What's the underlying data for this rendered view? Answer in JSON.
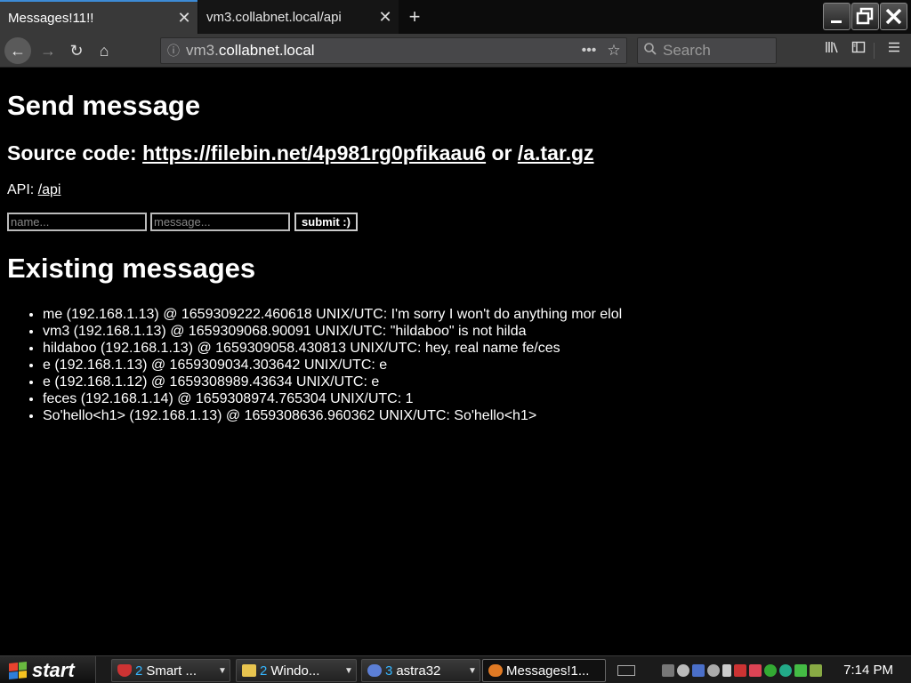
{
  "browser": {
    "tabs": [
      {
        "title": "Messages!11!!",
        "active": true
      },
      {
        "title": "vm3.collabnet.local/api",
        "active": false
      }
    ],
    "url": {
      "prefix": "vm3.",
      "domain": "collabnet.local"
    },
    "search_placeholder": "Search"
  },
  "page": {
    "title": "Send message",
    "source_label": "Source code:",
    "source_link": "https://filebin.net/4p981rg0pfikaau6",
    "source_or": "or",
    "source_link2": "/a.tar.gz",
    "api_label": "API:",
    "api_link": "/api",
    "form": {
      "name_placeholder": "name...",
      "message_placeholder": "message...",
      "submit_label": "submit :)"
    },
    "existing_title": "Existing messages",
    "messages": [
      "me (192.168.1.13) @ 1659309222.460618 UNIX/UTC: I'm sorry I won't do anything mor elol",
      "vm3 (192.168.1.13) @ 1659309068.90091 UNIX/UTC: \"hildaboo\" is not hilda",
      "hildaboo (192.168.1.13) @ 1659309058.430813 UNIX/UTC: hey, real name fe/ces",
      "e (192.168.1.13) @ 1659309034.303642 UNIX/UTC: e",
      "e (192.168.1.12) @ 1659308989.43634 UNIX/UTC: e",
      "feces (192.168.1.14) @ 1659308974.765304 UNIX/UTC: 1",
      "So'hello<h1> (192.168.1.13) @ 1659308636.960362 UNIX/UTC: So'hello<h1>"
    ]
  },
  "taskbar": {
    "start_label": "start",
    "tasks": [
      {
        "count": "2",
        "label": "Smart ..."
      },
      {
        "count": "2",
        "label": "Windo..."
      },
      {
        "count": "3",
        "label": "astra32"
      },
      {
        "count": "",
        "label": "Messages!1..."
      }
    ],
    "clock": "7:14 PM"
  },
  "colors": {
    "active_tab_accent": "#3d8bd6",
    "taskbar_count": "#35b6ff",
    "page_background": "#000000"
  },
  "icons": [
    "close-icon",
    "plus-icon",
    "minimize-icon",
    "maximize-icon",
    "back-arrow-icon",
    "forward-arrow-icon",
    "reload-icon",
    "home-icon",
    "info-icon",
    "more-dots-icon",
    "bookmark-star-icon",
    "search-icon",
    "library-icon",
    "sidebar-icon",
    "hamburger-menu-icon",
    "windows-logo-icon",
    "folder-icon",
    "keyboard-icon"
  ]
}
